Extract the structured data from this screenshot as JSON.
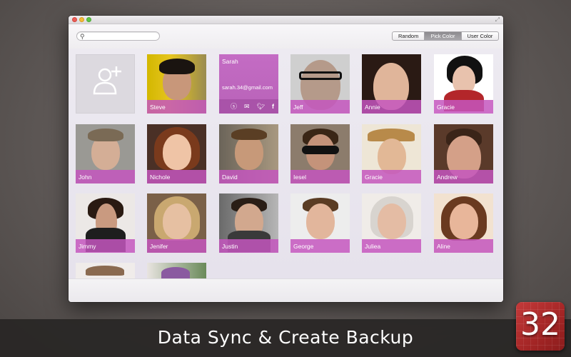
{
  "toolbar": {
    "search_placeholder": "",
    "search_value": "",
    "segments": [
      {
        "label": "Random",
        "active": false
      },
      {
        "label": "Pick Color",
        "active": true
      },
      {
        "label": "User Color",
        "active": false
      }
    ]
  },
  "add_contact": {
    "icon": "add-person-icon"
  },
  "selected_contact": {
    "name": "Sarah",
    "email": "sarah.34@gmail.com",
    "actions": [
      "skype-icon",
      "mail-icon",
      "twitter-icon",
      "facebook-icon"
    ]
  },
  "contacts": [
    {
      "name": "Steve"
    },
    {
      "name": "Jeff"
    },
    {
      "name": "Annie"
    },
    {
      "name": "Gracie"
    },
    {
      "name": "John"
    },
    {
      "name": "Nichole"
    },
    {
      "name": "David"
    },
    {
      "name": "Iesel"
    },
    {
      "name": "Gracie"
    },
    {
      "name": "Andrew"
    },
    {
      "name": "Jimmy"
    },
    {
      "name": "Jenifer"
    },
    {
      "name": "Justin"
    },
    {
      "name": "George"
    },
    {
      "name": "Juliea"
    },
    {
      "name": "Aline"
    }
  ],
  "accent_color": "#c456be",
  "banner": {
    "text": "Data Sync & Create Backup"
  },
  "app_icon": {
    "label": "32"
  }
}
